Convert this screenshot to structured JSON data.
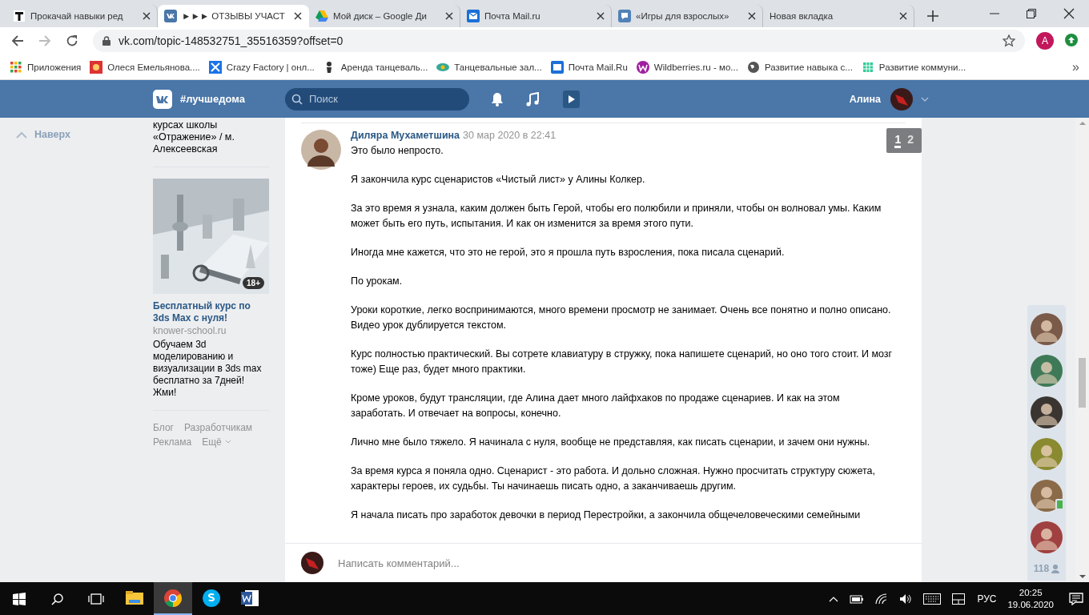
{
  "browser": {
    "tabs": [
      {
        "title": "Прокачай навыки ред",
        "selected": false
      },
      {
        "title": "►►► ОТЗЫВЫ УЧАСТ",
        "selected": true
      },
      {
        "title": "Мой диск – Google Ди",
        "selected": false
      },
      {
        "title": "Почта Mail.ru",
        "selected": false
      },
      {
        "title": "«Игры для взрослых»",
        "selected": false
      },
      {
        "title": "Новая вкладка",
        "selected": false
      }
    ],
    "address": "vk.com/topic-148532751_35516359?offset=0",
    "profile_initial": "A",
    "bookmarks": [
      {
        "title": "Приложения"
      },
      {
        "title": "Олеся Емельянова...."
      },
      {
        "title": "Crazy Factory | онл..."
      },
      {
        "title": "Аренда танцеваль..."
      },
      {
        "title": "Танцевальные зал..."
      },
      {
        "title": "Почта Mail.Ru"
      },
      {
        "title": "Wildberries.ru - мо..."
      },
      {
        "title": "Развитие навыка с..."
      },
      {
        "title": "Развитие коммуни..."
      }
    ],
    "more": "»"
  },
  "header": {
    "hashtag": "#лучшедома",
    "search": {
      "placeholder": "Поиск"
    },
    "user": "Алина"
  },
  "left": {
    "up": "Наверх"
  },
  "ads": {
    "prev_text": "курсах школы «Отражение» / м. Алексеевская",
    "age": "18+",
    "title": "Бесплатный курс по 3ds Max с нуля!",
    "domain": "knower-school.ru",
    "text": "Обучаем 3d моделированию и визуализации в 3ds max бесплатно за 7дней! Жми!"
  },
  "footer_links": [
    "Блог",
    "Разработчикам",
    "Реклама",
    "Ещё"
  ],
  "post": {
    "author": "Диляра Мухаметшина",
    "date": "30 мар 2020 в 22:41",
    "paragraphs": [
      "Это было непросто.",
      "Я закончила курс сценаристов «Чистый лист» у Алины Колкер.",
      "За это время я узнала, каким должен быть Герой, чтобы его полюбили и приняли, чтобы он волновал умы. Каким может быть его путь, испытания. И как он изменится за время этого пути.",
      "Иногда мне кажется, что это не герой, это я прошла путь взросления, пока писала сценарий.",
      "По урокам.",
      "Уроки короткие, легко воспринимаются, много времени просмотр не занимает. Очень все понятно и полно описано. Видео урок дублируется текстом.",
      "Курс полностью практический. Вы сотрете клавиатуру в стружку, пока напишете сценарий, но оно того стоит. И мозг тоже) Еще раз, будет много практики.",
      "Кроме уроков, будут трансляции, где Алина дает много лайфхаков по продаже сценариев. И как на этом заработать. И отвечает на вопросы, конечно.",
      "Лично мне было тяжело. Я начинала с нуля, вообще не представляя, как писать сценарии, и зачем они нужны.",
      "За время курса я поняла одно. Сценарист - это работа. И дольно сложная. Нужно просчитать структуру сюжета, характеры героев, их судьбы. Ты начинаешь писать одно, а заканчиваешь другим.",
      "Я начала писать про заработок девочки в период Перестройки, а закончила общечеловеческими семейными"
    ],
    "pages": [
      {
        "label": "1",
        "selected": true
      },
      {
        "label": "2",
        "selected": false
      }
    ]
  },
  "comment": {
    "placeholder": "Написать комментарий..."
  },
  "members": {
    "avatars": [
      {
        "color": "#7a5a48",
        "online": false
      },
      {
        "color": "#3f7a58",
        "online": false
      },
      {
        "color": "#3a3530",
        "online": false
      },
      {
        "color": "#8a8a30",
        "online": false
      },
      {
        "color": "#8a6a48",
        "online": true
      },
      {
        "color": "#a04040",
        "online": false
      }
    ],
    "count": "118"
  },
  "taskbar": {
    "apps": [
      {
        "kind": "explorer",
        "selected": false
      },
      {
        "kind": "chrome",
        "selected": true
      },
      {
        "kind": "skype",
        "selected": false
      },
      {
        "kind": "word",
        "selected": false
      }
    ],
    "language": "РУС",
    "time": "20:25",
    "date": "19.06.2020"
  }
}
